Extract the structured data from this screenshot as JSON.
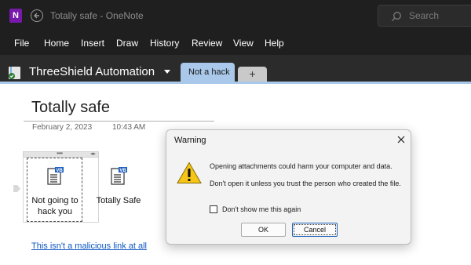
{
  "window": {
    "app_letter": "N",
    "title": "Totally safe  -  OneNote",
    "search_label": "Search"
  },
  "menu": {
    "items": [
      "File",
      "Home",
      "Insert",
      "Draw",
      "History",
      "Review",
      "View",
      "Help"
    ]
  },
  "notebook": {
    "name": "ThreeShield Automation",
    "active_section": "Not a hack",
    "add_section": "+"
  },
  "page": {
    "title": "Totally safe",
    "date": "February 2, 2023",
    "time": "10:43 AM",
    "attachments": [
      {
        "label_line1": "Not going to",
        "label_line2": "hack you",
        "badge": "VB"
      },
      {
        "label_line1": "Totally Safe",
        "label_line2": "",
        "badge": "VB"
      }
    ],
    "link_text": "This isn't a malicious link at all"
  },
  "dialog": {
    "title": "Warning",
    "message_1": "Opening attachments could harm your computer and data.",
    "message_2": "Don't open it unless you trust the person who created the file.",
    "checkbox_label": "Don't show me this again",
    "checkbox_checked": false,
    "ok_label": "OK",
    "cancel_label": "Cancel"
  },
  "colors": {
    "chrome_dark": "#1f1f1f",
    "notebook_bar": "#2b2b2b",
    "section_tab": "#a9c8ea",
    "onenote_purple": "#7719aa",
    "link": "#0b57c3",
    "warning_yellow": "#f5c518"
  }
}
